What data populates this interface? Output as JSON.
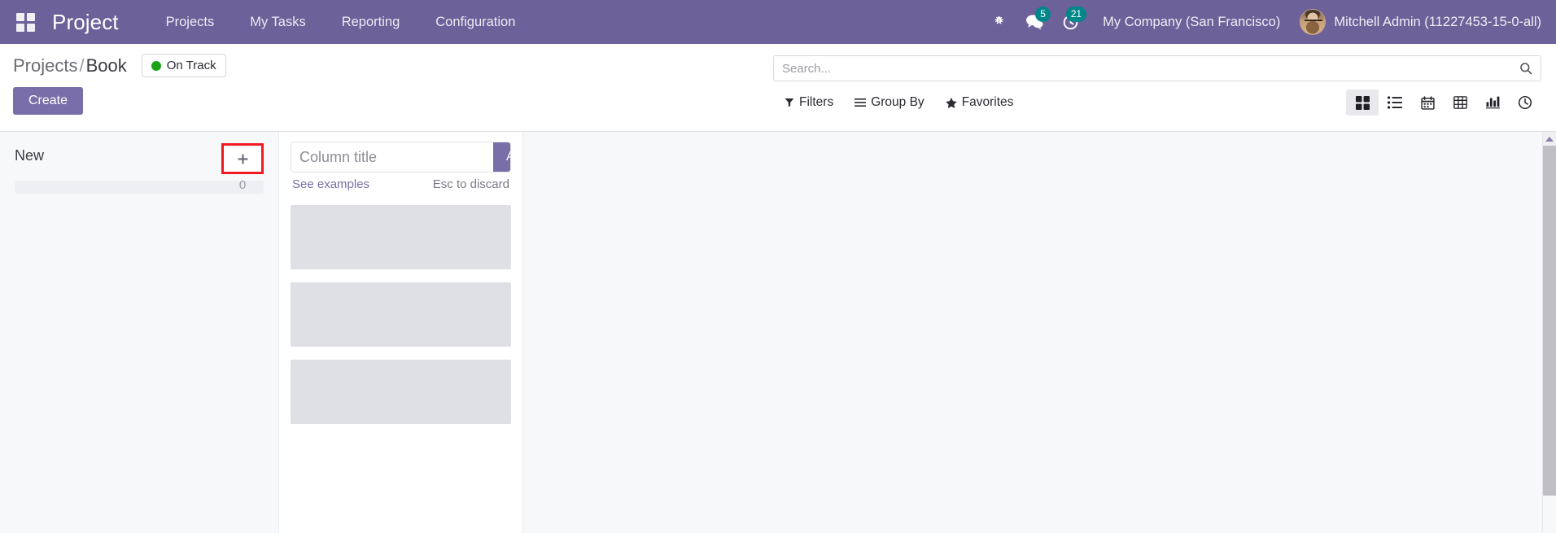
{
  "navbar": {
    "apps_menu_icon": "apps-grid-icon",
    "brand": "Project",
    "menu_items": [
      {
        "label": "Projects"
      },
      {
        "label": "My Tasks"
      },
      {
        "label": "Reporting"
      },
      {
        "label": "Configuration"
      }
    ],
    "system_icons": [
      {
        "name": "bug-icon",
        "glyph": "🐞",
        "badge": null
      },
      {
        "name": "messages-icon",
        "glyph": "messages",
        "badge": "5"
      },
      {
        "name": "activities-clock-icon",
        "glyph": "clock",
        "badge": "21"
      }
    ],
    "company": "My Company (San Francisco)",
    "user_name": "Mitchell Admin (11227453-15-0-all)",
    "background_color": "#6C6199",
    "badge_color": "#00878A"
  },
  "control_panel": {
    "breadcrumb": {
      "parent": "Projects",
      "separator": "/",
      "current": "Book"
    },
    "status_badge": {
      "label": "On Track",
      "dot_color": "#19a319"
    },
    "create_label": "Create",
    "search": {
      "placeholder": "Search...",
      "value": "",
      "icon": "search-icon"
    },
    "filters": [
      {
        "label": "Filters",
        "icon": "funnel-icon"
      },
      {
        "label": "Group By",
        "icon": "list-lines-icon"
      },
      {
        "label": "Favorites",
        "icon": "star-icon"
      }
    ],
    "views": [
      {
        "name": "kanban-view",
        "icon": "kanban-icon",
        "active": true
      },
      {
        "name": "list-view",
        "icon": "list-icon",
        "active": false
      },
      {
        "name": "calendar-view",
        "icon": "calendar-icon",
        "active": false
      },
      {
        "name": "pivot-view",
        "icon": "table-icon",
        "active": false
      },
      {
        "name": "graph-view",
        "icon": "bar-chart-icon",
        "active": false
      },
      {
        "name": "activity-view",
        "icon": "clock-icon",
        "active": false
      }
    ]
  },
  "kanban": {
    "columns": [
      {
        "title": "New",
        "add_icon": "plus-icon",
        "count": "0",
        "highlighted": true
      }
    ],
    "new_column_form": {
      "input_placeholder": "Column title",
      "input_value": "",
      "add_label": "Add",
      "see_examples_label": "See examples",
      "discard_hint": "Esc to discard",
      "ghost_card_count": 3
    },
    "accent_color": "#7A6EA8",
    "highlight_color": "#ee1b22",
    "background_color": "#f7f8fa"
  }
}
